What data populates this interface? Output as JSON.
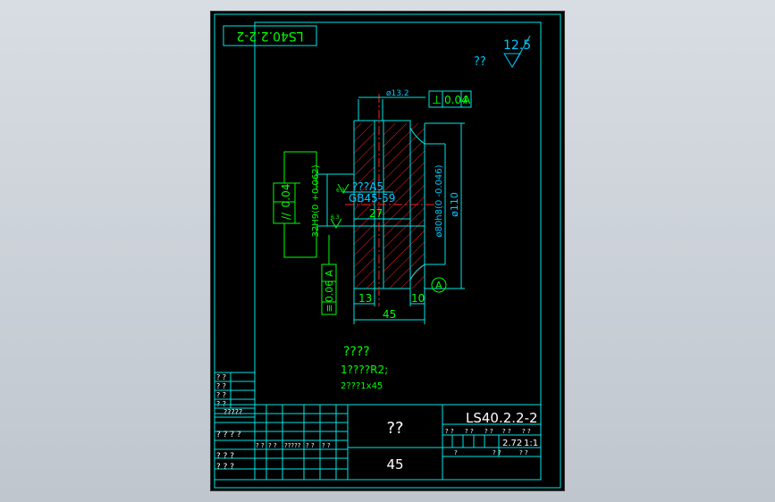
{
  "colors": {
    "background": "#000000",
    "frame": "#00e6e6",
    "annotation": "#00ff00",
    "text_cyan": "#00c8ff",
    "hatch": "#ff2020",
    "title_text": "#ffffff",
    "center_line": "#ff2020"
  },
  "drawing": {
    "rotated_code": "LS40.2.2-2",
    "roughness_value": "12.5",
    "roughness_label": "??",
    "dim_hole_top": "ø13.2",
    "perp_tol_value": "0.04",
    "perp_tol_datum": "A",
    "perp_symbol": "⊥",
    "parallel_symbol": "//",
    "parallel_tol_value": "0.04",
    "symmetry_symbol": "≡",
    "symmetry_tol_value": "0.06",
    "symmetry_datum": "A",
    "bore_dim": "32H9(0 +0.062)",
    "key_std_1": "???A5",
    "key_std_2": "GB45-59",
    "roughness_small_1": "6.3",
    "roughness_small_2": "6.3",
    "dim_27": "27",
    "dim_fit": "ø80h8(0 -0.046)",
    "dim_outer": "ø110",
    "dim_13": "13",
    "dim_10": "10",
    "dim_45": "45",
    "datum_label": "A"
  },
  "notes": {
    "title": "????",
    "line1": "1????R2;",
    "line2": "2???1x45"
  },
  "left_strip": [
    "? ?",
    "? ?",
    "? ?",
    "? ?",
    "?????"
  ],
  "title_block": {
    "part_name": "??",
    "material": "45",
    "drawing_no": "LS40.2.2-2",
    "weight": "2.72",
    "scale": "1:1",
    "row_labels": [
      "? ? ? ?",
      "? ? ?",
      "? ? ?"
    ],
    "cell_labels": [
      "? ?",
      "? ?",
      "?????",
      "? ?",
      "? ?"
    ],
    "sheet_cells": [
      "? ?",
      "? ?",
      "? ?",
      "? ?",
      "? ?"
    ],
    "bottom_cells": [
      "?",
      "? ?",
      "? ?"
    ]
  }
}
